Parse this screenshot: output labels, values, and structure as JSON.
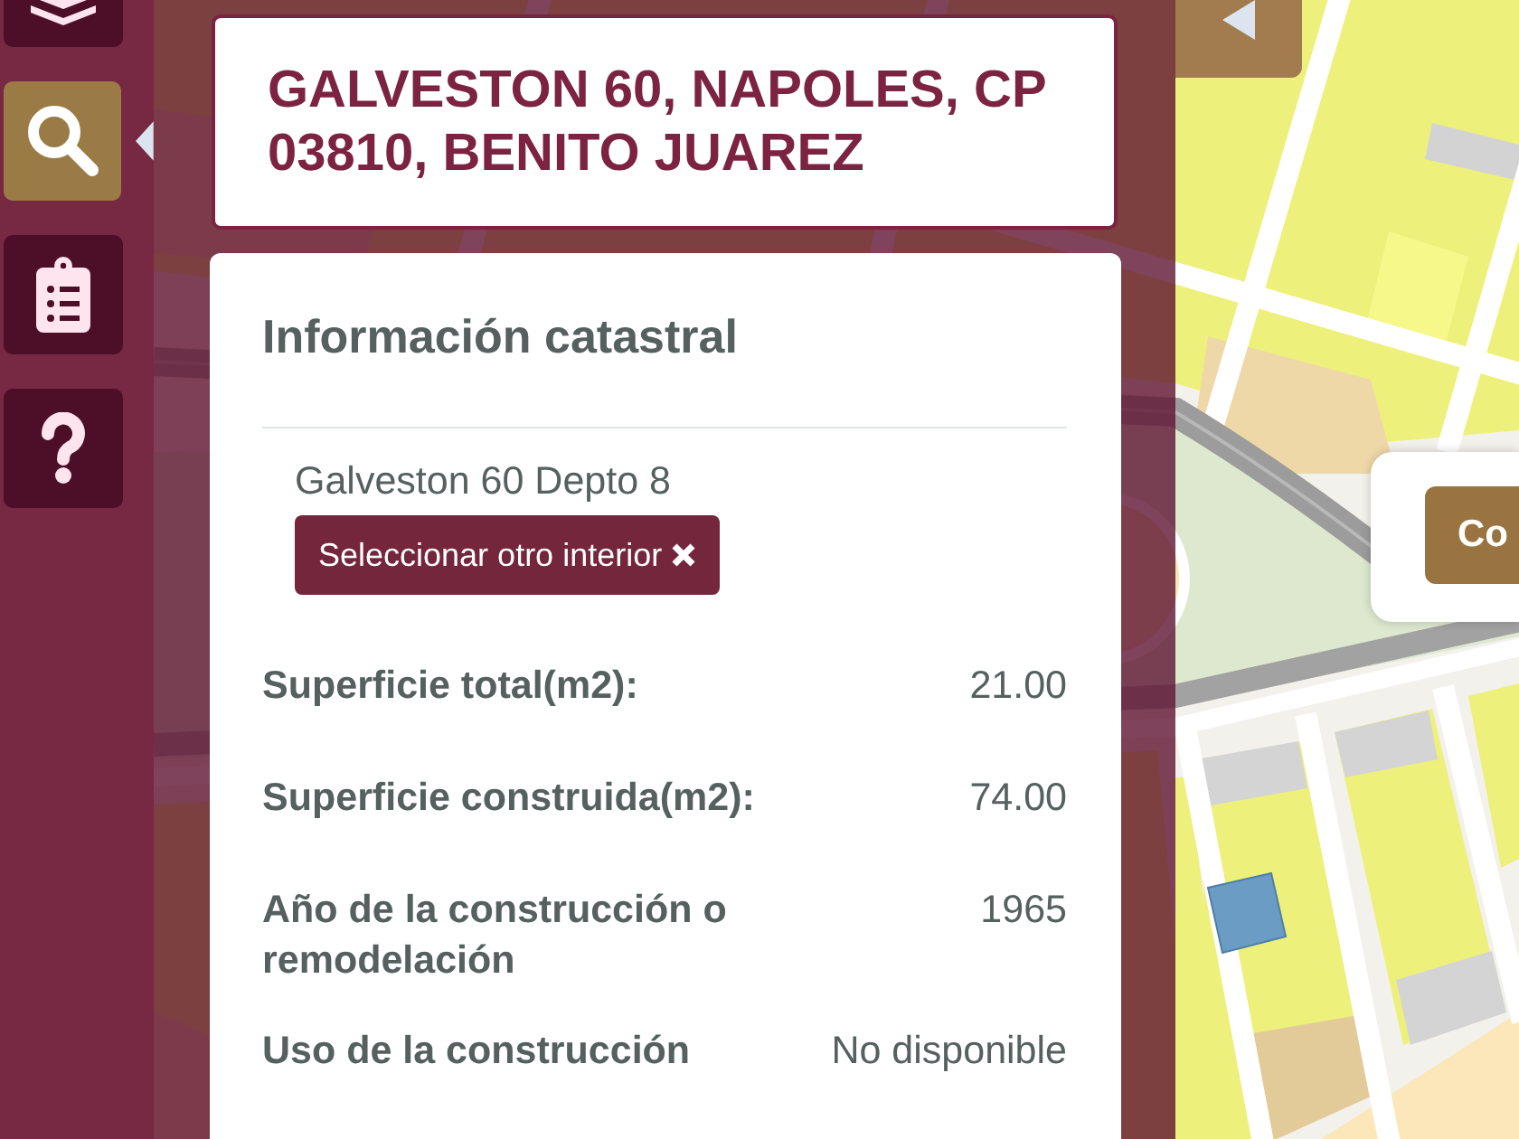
{
  "sidebar": {
    "items": [
      {
        "kind": "layers",
        "selected": false
      },
      {
        "kind": "search",
        "selected": true
      },
      {
        "kind": "checklist",
        "selected": false
      },
      {
        "kind": "help",
        "selected": false
      }
    ]
  },
  "address": {
    "title": "GALVESTON 60, NAPOLES, CP 03810, BENITO JUAREZ"
  },
  "info_card": {
    "title": "Información catastral",
    "unit": "Galveston 60 Depto 8",
    "change_button": {
      "label": "Seleccionar otro interior"
    },
    "fields": [
      {
        "label": "Superficie total(m2):",
        "value": "21.00"
      },
      {
        "label": "Superficie construida(m2):",
        "value": "74.00"
      },
      {
        "label": "Año de la construcción o remodelación",
        "value": "1965"
      },
      {
        "label": "Uso de la construcción",
        "value": "No disponible"
      }
    ]
  },
  "map": {
    "popup": {
      "button": {
        "label": "Co"
      }
    }
  }
}
